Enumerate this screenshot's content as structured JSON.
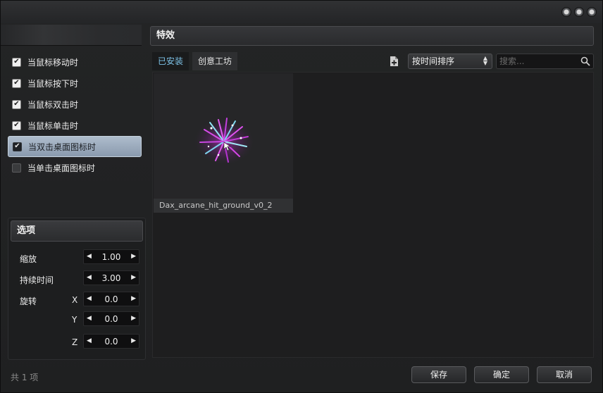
{
  "left": {
    "triggers": [
      {
        "label": "当鼠标移动时",
        "checked": true
      },
      {
        "label": "当鼠标按下时",
        "checked": true
      },
      {
        "label": "当鼠标双击时",
        "checked": true
      },
      {
        "label": "当鼠标单击时",
        "checked": true
      },
      {
        "label": "当双击桌面图标时",
        "checked": true,
        "selected": true
      },
      {
        "label": "当单击桌面图标时",
        "checked": false
      }
    ],
    "options": {
      "title": "选项",
      "scale_label": "缩放",
      "scale_value": "1.00",
      "duration_label": "持续时间",
      "duration_value": "3.00",
      "rotate_label": "旋转",
      "x_label": "X",
      "x_value": "0.0",
      "y_label": "Y",
      "y_value": "0.0",
      "z_label": "Z",
      "z_value": "0.0"
    },
    "count_text": "共 1 项"
  },
  "effects": {
    "title": "特效",
    "tabs": [
      {
        "label": "已安装",
        "active": true
      },
      {
        "label": "创意工坊",
        "active": false
      }
    ],
    "sort_value": "按时间排序",
    "search_placeholder": "搜索...",
    "items": [
      {
        "name": "Dax_arcane_hit_ground_v0_2"
      }
    ]
  },
  "buttons": {
    "save": "保存",
    "ok": "确定",
    "cancel": "取消"
  },
  "colors": {
    "active_tab_text": "#7ec3e8",
    "selected_row": "#9aaabd"
  }
}
